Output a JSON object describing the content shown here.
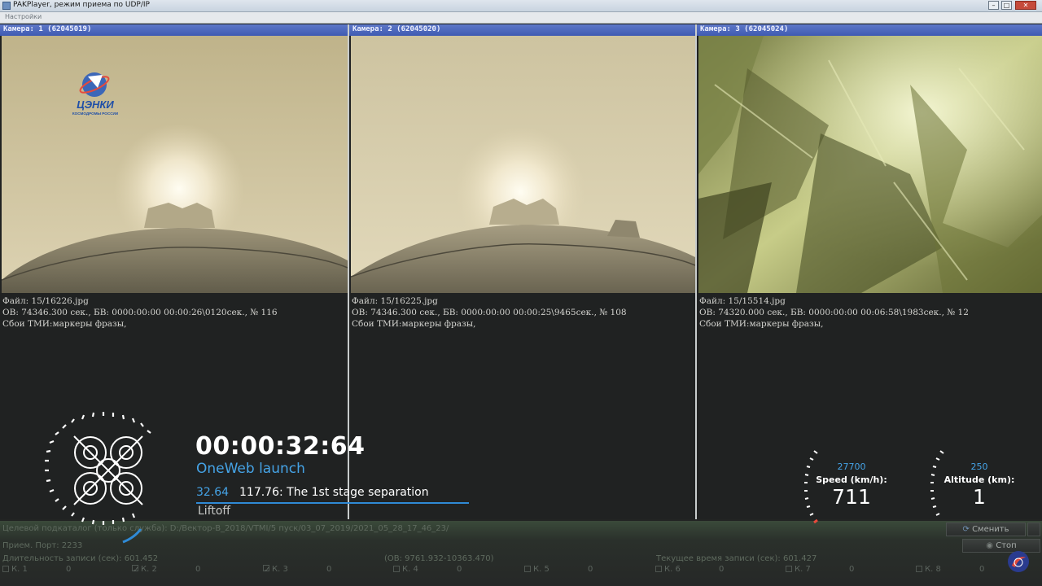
{
  "window": {
    "title": "PAKPlayer, режим приема по UDP/IP",
    "menu_item": "Настройки"
  },
  "cameras": [
    {
      "header": "Камера: 1 (62045019)",
      "file": "Файл: 15/16226.jpg",
      "timing": "ОВ: 74346.300 сек., БВ: 0000:00:00 00:00:26\\0120сек., № 116",
      "errors": "Сбои ТМИ:маркеры фразы,",
      "logo": {
        "main": "ЦЭНКИ",
        "sub": "КОСМОДРОМЫ РОССИИ"
      }
    },
    {
      "header": "Камера: 2 (62045020)",
      "file": "Файл: 15/16225.jpg",
      "timing": "ОВ: 74346.300 сек., БВ: 0000:00:00 00:00:25\\9465сек., № 108",
      "errors": "Сбои ТМИ:маркеры фразы,"
    },
    {
      "header": "Камера: 3 (62045024)",
      "file": "Файл: 15/15514.jpg",
      "timing": "ОВ: 74320.000 сек., БВ: 0000:00:00 00:06:58\\1983сек., № 12",
      "errors": "Сбои ТМИ:маркеры фразы,"
    }
  ],
  "overlay": {
    "timer": "00:00:32:64",
    "mission": "OneWeb launch",
    "event_time": "32.64",
    "event_text": "117.76: The 1st stage separation",
    "phase": "Liftoff",
    "speed": {
      "max": "27700",
      "label": "Speed (km/h):",
      "value": "711"
    },
    "altitude": {
      "max": "250",
      "label": "Altitude (km):",
      "value": "1"
    }
  },
  "status": {
    "target_dir": "Целевой подкаталог (только служба): D:/Вектор-В_2018/VTMI/5 пуск/03_07_2019/2021_05_28_17_46_23/",
    "port": "Прием. Порт: 2233",
    "duration": "Длительность записи (сек): 601.452",
    "ob_range": "(ОВ: 9761.932-10363.470)",
    "current_time": "Текущее время записи (сек): 601.427",
    "change_button": "Сменить",
    "stop_button": "Стоп",
    "channels": [
      {
        "label": "К. 1",
        "value": "0",
        "checked": false
      },
      {
        "label": "К. 2",
        "value": "0",
        "checked": true
      },
      {
        "label": "К. 3",
        "value": "0",
        "checked": true
      },
      {
        "label": "К. 4",
        "value": "0",
        "checked": false
      },
      {
        "label": "К. 5",
        "value": "0",
        "checked": false
      },
      {
        "label": "К. 6",
        "value": "0",
        "checked": false
      },
      {
        "label": "К. 7",
        "value": "0",
        "checked": false
      },
      {
        "label": "К. 8",
        "value": "0",
        "checked": false
      }
    ]
  },
  "colors": {
    "accent_blue": "#45a3e6",
    "header_blue": "#4a65bd",
    "background": "#222423"
  }
}
